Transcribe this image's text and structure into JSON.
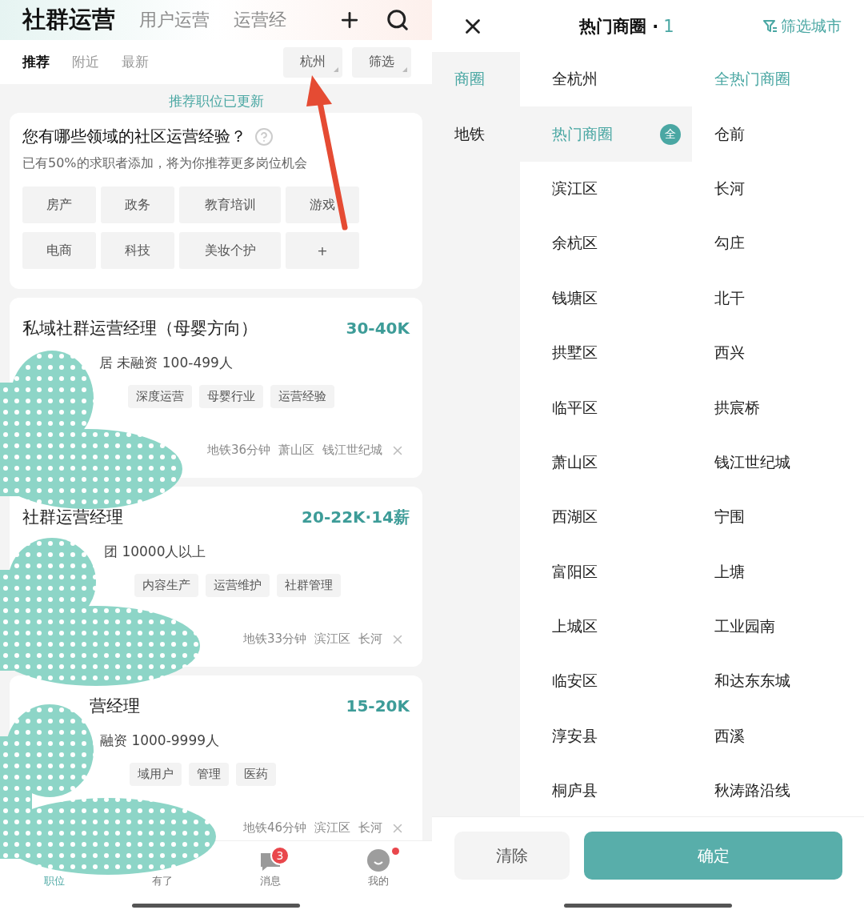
{
  "left": {
    "top_tabs": [
      {
        "label": "社群运营",
        "selected": true
      },
      {
        "label": "用户运营",
        "selected": false
      },
      {
        "label": "运营经",
        "selected": false
      }
    ],
    "sub_tabs": [
      {
        "label": "推荐",
        "selected": true
      },
      {
        "label": "附近",
        "selected": false
      },
      {
        "label": "最新",
        "selected": false
      }
    ],
    "filters": [
      "杭州",
      "筛选"
    ],
    "notice": "推荐职位已更新",
    "survey": {
      "title": "您有哪些领域的社区运营经验？",
      "subtitle": "已有50%的求职者添加，将为你推荐更多岗位机会",
      "tags": [
        "房产",
        "政务",
        "教育培训",
        "游戏",
        "电商",
        "科技",
        "美妆个护",
        "+"
      ]
    },
    "jobs": [
      {
        "title": "私域社群运营经理（母婴方向）",
        "salary": "30-40K",
        "company": "居 未融资 100-499人",
        "tags": [
          "深度运营",
          "母婴行业",
          "运营经验"
        ],
        "location": [
          "地铁36分钟",
          "萧山区",
          "钱江世纪城"
        ]
      },
      {
        "title": "社群运营经理",
        "salary": "20-22K·14薪",
        "company": "团 10000人以上",
        "tags": [
          "内容生产",
          "运营维护",
          "社群管理"
        ],
        "location": [
          "地铁33分钟",
          "滨江区",
          "长河"
        ]
      },
      {
        "title": "营经理",
        "salary": "15-20K",
        "company": "融资 1000-9999人",
        "tags": [
          "域用户",
          "管理",
          "医药"
        ],
        "location": [
          "地铁46分钟",
          "滨江区",
          "长河"
        ]
      }
    ],
    "nav": [
      {
        "label": "职位",
        "selected": true
      },
      {
        "label": "有了",
        "selected": false
      },
      {
        "label": "消息",
        "selected": false,
        "badge": "3"
      },
      {
        "label": "我的",
        "selected": false,
        "dot": true
      }
    ]
  },
  "right": {
    "header": {
      "title": "热门商圈",
      "separator": "·",
      "count": "1",
      "action": "筛选城市"
    },
    "categories": [
      {
        "label": "商圈",
        "selected": true
      },
      {
        "label": "地铁",
        "selected": false
      }
    ],
    "areas": [
      {
        "label": "全杭州",
        "selected": false
      },
      {
        "label": "热门商圈",
        "selected": true,
        "badge": "全"
      },
      {
        "label": "滨江区",
        "selected": false
      },
      {
        "label": "余杭区",
        "selected": false
      },
      {
        "label": "钱塘区",
        "selected": false
      },
      {
        "label": "拱墅区",
        "selected": false
      },
      {
        "label": "临平区",
        "selected": false
      },
      {
        "label": "萧山区",
        "selected": false
      },
      {
        "label": "西湖区",
        "selected": false
      },
      {
        "label": "富阳区",
        "selected": false
      },
      {
        "label": "上城区",
        "selected": false
      },
      {
        "label": "临安区",
        "selected": false
      },
      {
        "label": "淳安县",
        "selected": false
      },
      {
        "label": "桐庐县",
        "selected": false
      }
    ],
    "places": [
      {
        "label": "全热门商圈",
        "selected": true
      },
      {
        "label": "仓前",
        "selected": false
      },
      {
        "label": "长河",
        "selected": false
      },
      {
        "label": "勾庄",
        "selected": false
      },
      {
        "label": "北干",
        "selected": false
      },
      {
        "label": "西兴",
        "selected": false
      },
      {
        "label": "拱宸桥",
        "selected": false
      },
      {
        "label": "钱江世纪城",
        "selected": false
      },
      {
        "label": "宁围",
        "selected": false
      },
      {
        "label": "上塘",
        "selected": false
      },
      {
        "label": "工业园南",
        "selected": false
      },
      {
        "label": "和达东东城",
        "selected": false
      },
      {
        "label": "西溪",
        "selected": false
      },
      {
        "label": "秋涛路沿线",
        "selected": false
      }
    ],
    "buttons": [
      {
        "label": "清除",
        "kind": "secondary"
      },
      {
        "label": "确定",
        "kind": "primary"
      }
    ]
  }
}
